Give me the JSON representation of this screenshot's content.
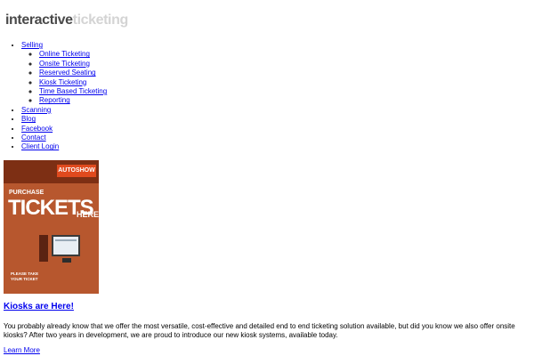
{
  "site": {
    "logo_part1": "interactive",
    "logo_part2": "ticketing"
  },
  "nav": {
    "selling": "Selling",
    "selling_items": [
      "Online Ticketing",
      "Onsite Ticketing",
      "Reserved Seating",
      "Kiosk Ticketing",
      "Time Based Ticketing",
      "Reporting"
    ],
    "scanning": "Scanning",
    "blog": "Blog",
    "facebook": "Facebook",
    "contact": "Contact",
    "client_login": "Client Login"
  },
  "poster": {
    "autoshow": "AUTOSHOW",
    "purchase": "PURCHASE",
    "tickets": "TICKETS",
    "here": "HERE!",
    "please_take": "PLEASE TAKE",
    "your_ticket": "YOUR TICKET"
  },
  "post": {
    "title": "Kiosks are Here!",
    "body": "You probably already know that we offer the most versatile, cost-effective and detailed end to end ticketing solution available, but did you know we also offer onsite kiosks? After two years in development, we are proud to introduce our new kiosk systems, available today.",
    "read_more": "Learn More"
  },
  "colors": {
    "link": "#0000ee",
    "logo_dark": "#4a4a4a",
    "logo_light": "#d4d4d4",
    "poster_red": "#b7572e"
  }
}
